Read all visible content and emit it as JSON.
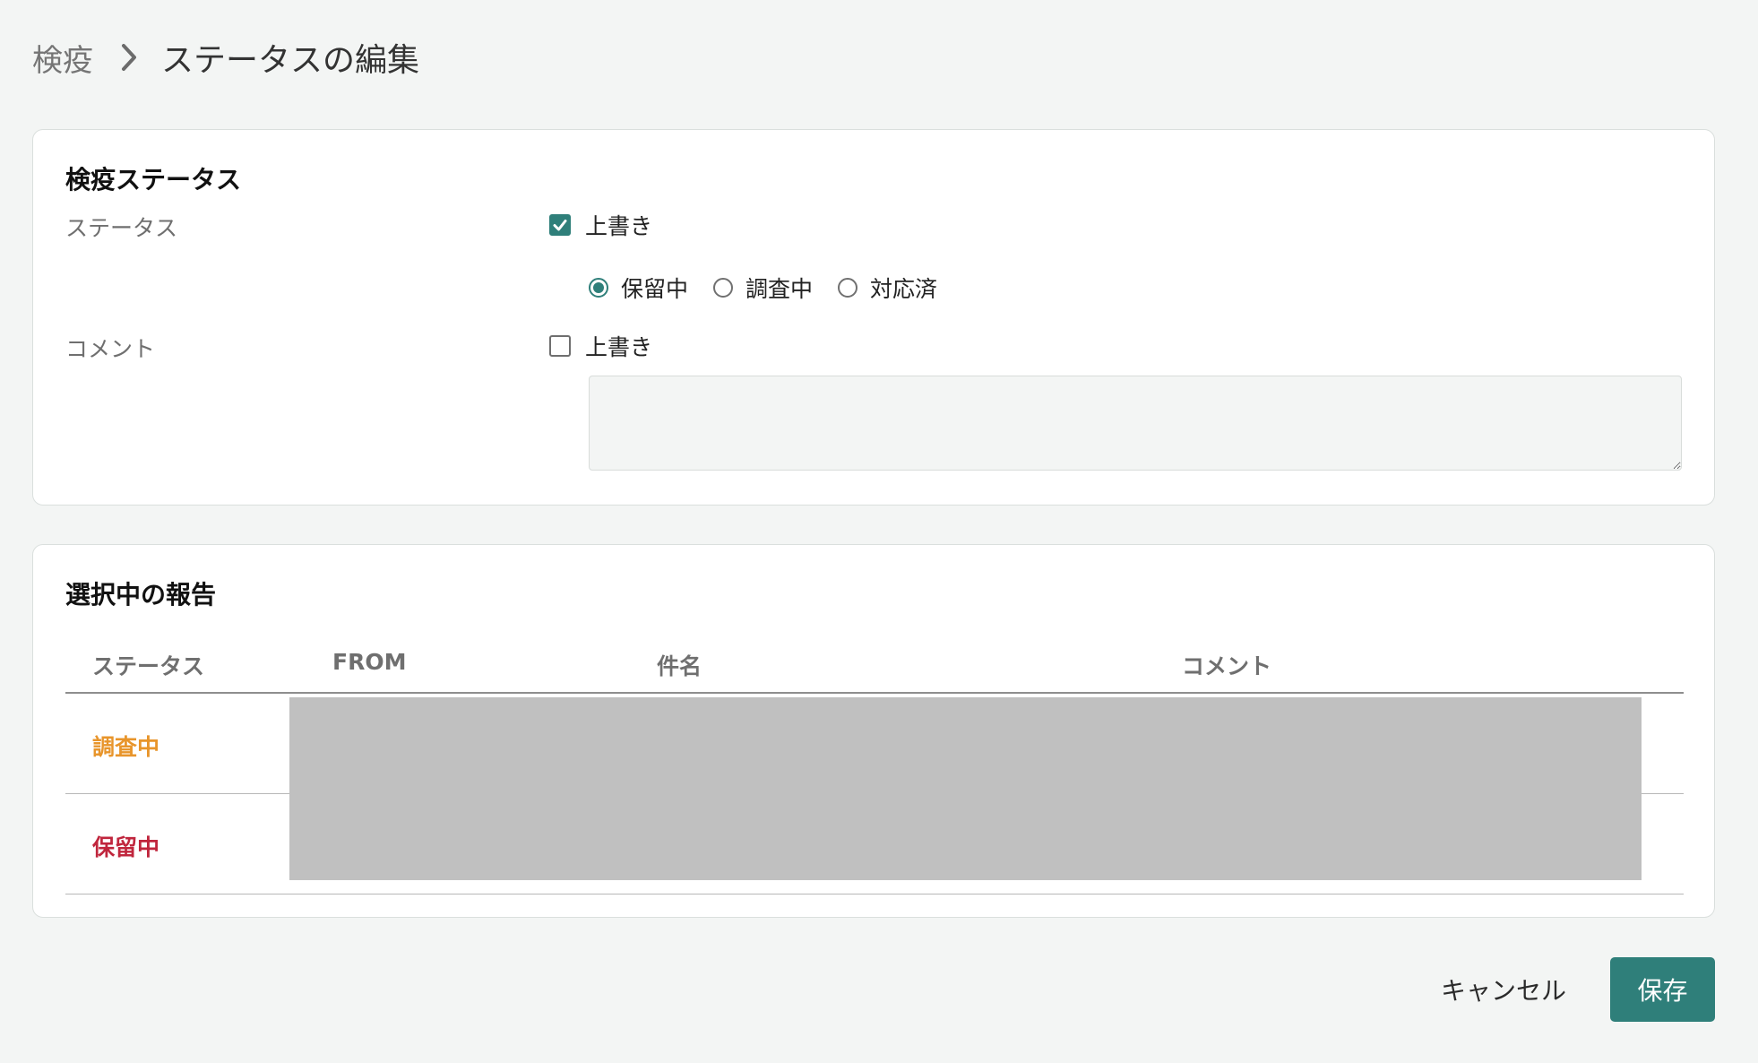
{
  "breadcrumb": {
    "parent": "検疫",
    "current": "ステータスの編集"
  },
  "status_card": {
    "title": "検疫ステータス",
    "status_label": "ステータス",
    "status_override": {
      "label": "上書き",
      "checked": true
    },
    "status_options": [
      {
        "label": "保留中",
        "selected": true
      },
      {
        "label": "調査中",
        "selected": false
      },
      {
        "label": "対応済",
        "selected": false
      }
    ],
    "comment_label": "コメント",
    "comment_override": {
      "label": "上書き",
      "checked": false
    },
    "comment_value": ""
  },
  "reports_card": {
    "title": "選択中の報告",
    "columns": [
      "ステータス",
      "FROM",
      "件名",
      "コメント"
    ],
    "rows": [
      {
        "status": "調査中",
        "status_color": "#e8952b"
      },
      {
        "status": "保留中",
        "status_color": "#c0263d"
      }
    ]
  },
  "actions": {
    "cancel": "キャンセル",
    "save": "保存"
  },
  "colors": {
    "accent": "#2f7f7a"
  }
}
